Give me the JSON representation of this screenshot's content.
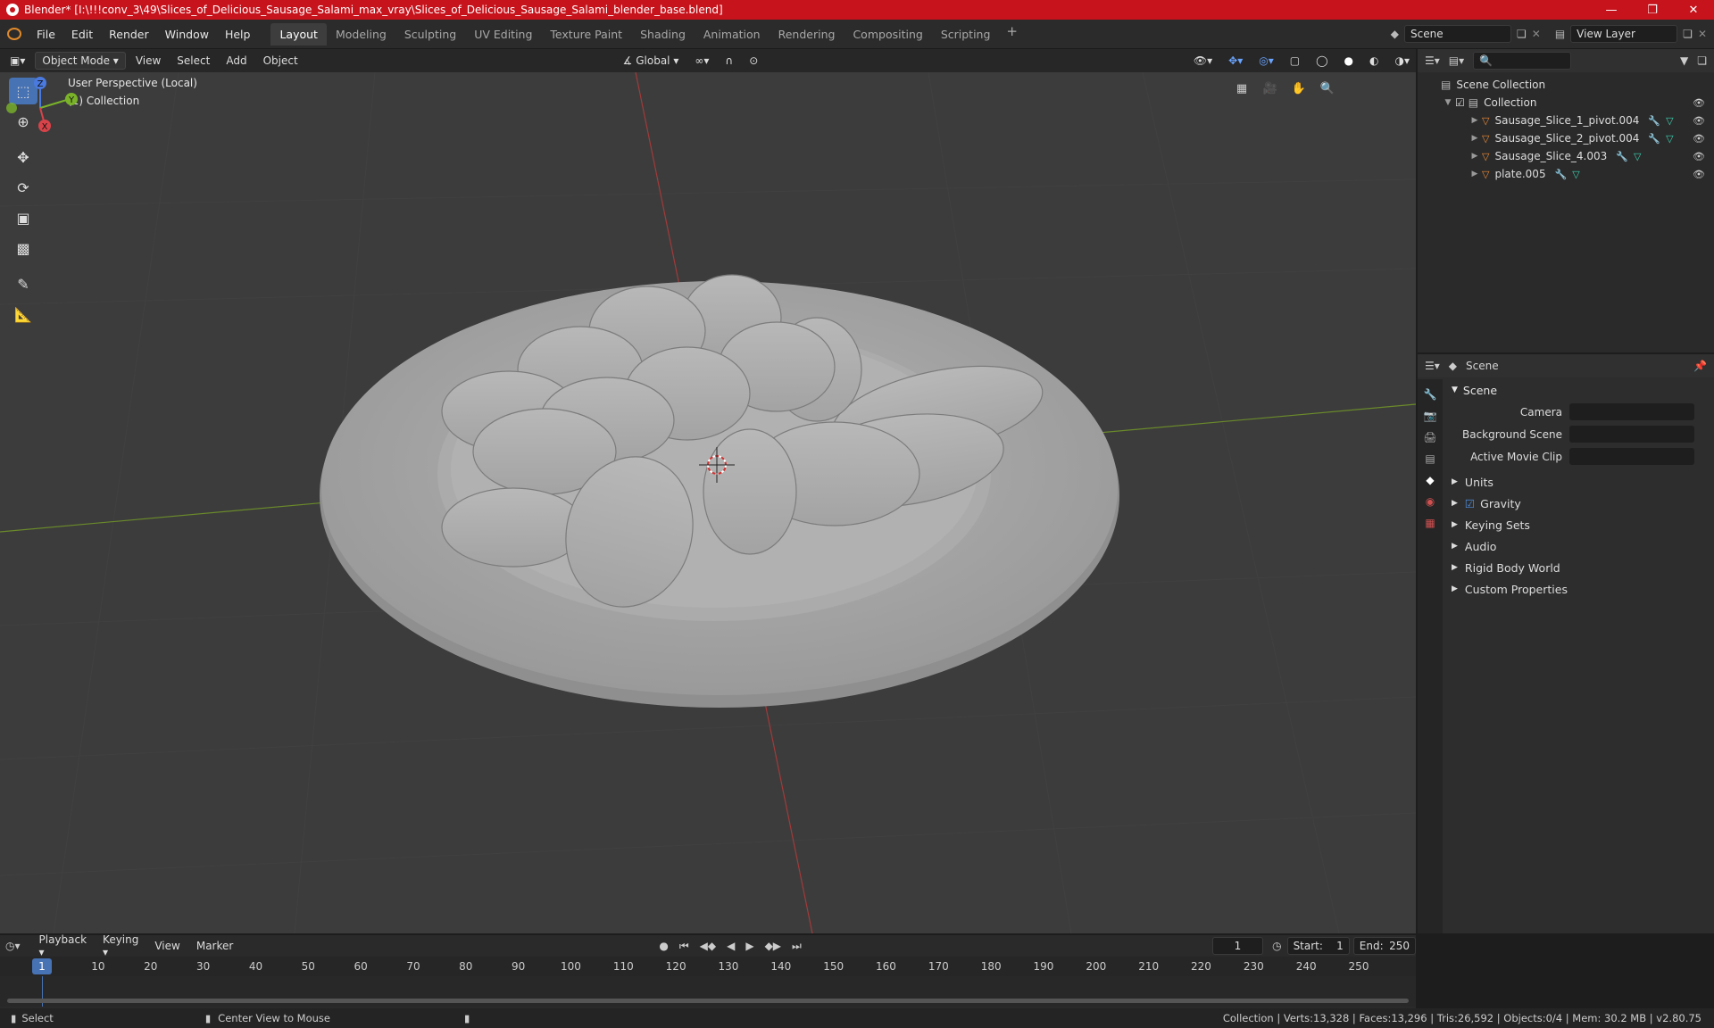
{
  "title": "Blender* [I:\\!!!conv_3\\49\\Slices_of_Delicious_Sausage_Salami_max_vray\\Slices_of_Delicious_Sausage_Salami_blender_base.blend]",
  "menu": [
    "File",
    "Edit",
    "Render",
    "Window",
    "Help"
  ],
  "workspaces": [
    "Layout",
    "Modeling",
    "Sculpting",
    "UV Editing",
    "Texture Paint",
    "Shading",
    "Animation",
    "Rendering",
    "Compositing",
    "Scripting"
  ],
  "active_workspace": "Layout",
  "scene_name": "Scene",
  "view_layer": "View Layer",
  "viewport_header": {
    "mode": "Object Mode",
    "view": "View",
    "select": "Select",
    "add": "Add",
    "object": "Object",
    "orientation": "Global"
  },
  "viewport_info": {
    "line1": "User Perspective (Local)",
    "line2": "(1) Collection"
  },
  "outliner": {
    "root": "Scene Collection",
    "collection": "Collection",
    "items": [
      "Sausage_Slice_1_pivot.004",
      "Sausage_Slice_2_pivot.004",
      "Sausage_Slice_4.003",
      "plate.005"
    ]
  },
  "properties": {
    "header": "Scene",
    "panel": "Scene",
    "fields": {
      "camera": "Camera",
      "background_scene": "Background Scene",
      "active_movie_clip": "Active Movie Clip"
    },
    "subpanels": [
      "Units",
      "Gravity",
      "Keying Sets",
      "Audio",
      "Rigid Body World",
      "Custom Properties"
    ]
  },
  "timeline": {
    "menus": [
      "Playback",
      "Keying",
      "View",
      "Marker"
    ],
    "current_frame": "1",
    "start_label": "Start:",
    "start": "1",
    "end_label": "End:",
    "end": "250",
    "ticks": [
      "10",
      "20",
      "30",
      "40",
      "50",
      "60",
      "70",
      "80",
      "90",
      "100",
      "110",
      "120",
      "130",
      "140",
      "150",
      "160",
      "170",
      "180",
      "190",
      "200",
      "210",
      "220",
      "230",
      "240",
      "250"
    ]
  },
  "status": {
    "select": "Select",
    "center": "Center View to Mouse",
    "stats": "Collection | Verts:13,328 | Faces:13,296 | Tris:26,592 | Objects:0/4 | Mem: 30.2 MB | v2.80.75"
  },
  "gizmo_axes": {
    "x": "X",
    "y": "Y",
    "z": "Z"
  }
}
